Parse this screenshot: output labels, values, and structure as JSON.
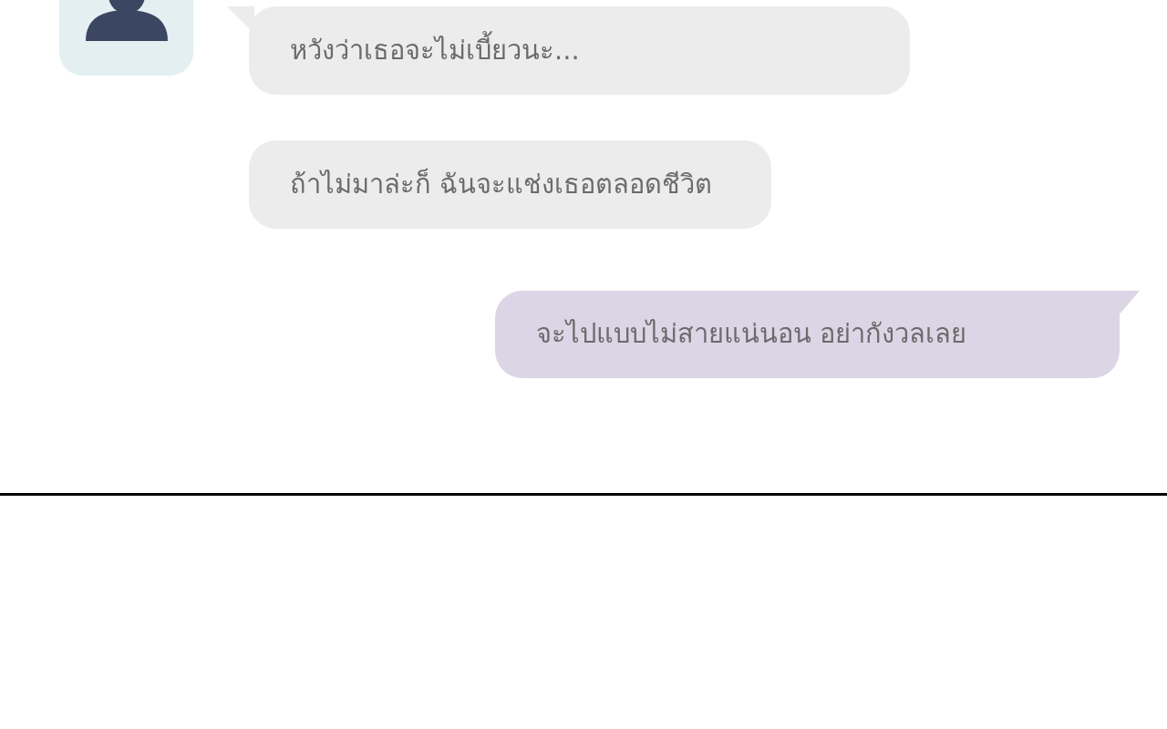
{
  "messages": [
    {
      "kind": "incoming",
      "text": "หวังว่าเธอจะไม่เบี้ยวนะ..."
    },
    {
      "kind": "incoming",
      "text": "ถ้าไม่มาล่ะก็ ฉันจะแช่งเธอตลอดชีวิต"
    },
    {
      "kind": "outgoing",
      "text": "จะไปแบบไม่สายแน่นอน อย่ากังวลเลย"
    }
  ]
}
